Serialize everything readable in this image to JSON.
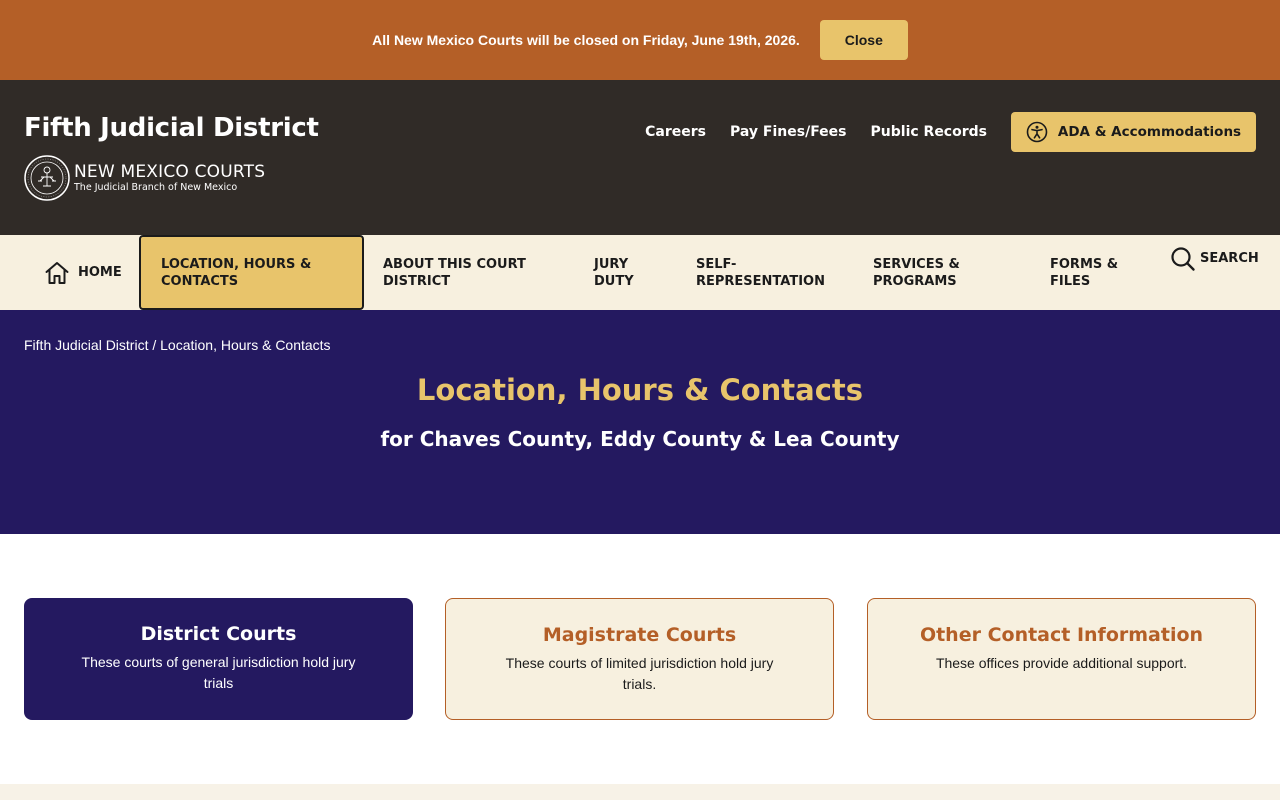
{
  "alert": {
    "message": "All New Mexico Courts will be closed on Friday, June 19th, 2026.",
    "close_label": "Close"
  },
  "header": {
    "site_title": "Fifth Judicial District",
    "logo_name": "NEW MEXICO COURTS",
    "logo_sub": "The Judicial Branch of New Mexico",
    "links": [
      "Careers",
      "Pay Fines/Fees",
      "Public Records"
    ],
    "ada_label": "ADA & Accommodations"
  },
  "nav": {
    "items": [
      {
        "label": "HOME",
        "icon": "home-icon"
      },
      {
        "label": "LOCATION, HOURS & CONTACTS",
        "active": true
      },
      {
        "label": "ABOUT THIS COURT DISTRICT"
      },
      {
        "label": "JURY DUTY"
      },
      {
        "label": "SELF-REPRESENTATION"
      },
      {
        "label": "SERVICES & PROGRAMS"
      },
      {
        "label": "FORMS & FILES"
      },
      {
        "label": "SEARCH",
        "icon": "search-icon"
      }
    ]
  },
  "breadcrumb": {
    "home": "Fifth Judicial District",
    "separator": " / ",
    "current": "Location, Hours & Contacts"
  },
  "hero": {
    "title": "Location, Hours & Contacts",
    "subtitle": "for Chaves County, Eddy County & Lea County"
  },
  "cards": [
    {
      "title": "District Courts",
      "description": "These courts of general jurisdiction hold jury trials"
    },
    {
      "title": "Magistrate Courts",
      "description": "These courts of limited jurisdiction hold jury trials."
    },
    {
      "title": "Other Contact Information",
      "description": "These offices provide additional support."
    }
  ],
  "colors": {
    "alert_bg": "#b45f27",
    "header_bg": "#302b27",
    "accent_gold": "#e8c46b",
    "hero_purple": "#241960",
    "nav_bg": "#f7f0df"
  }
}
